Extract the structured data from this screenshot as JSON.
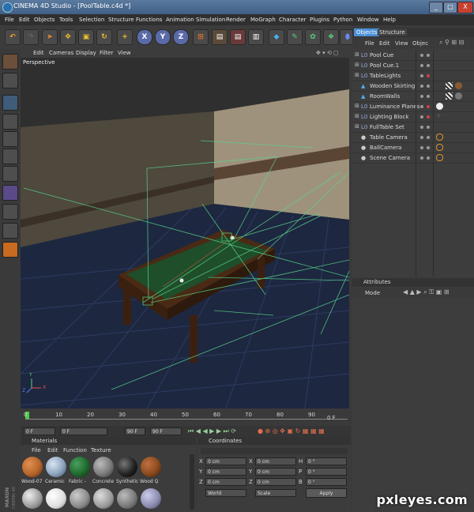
{
  "titlebar": {
    "title": "CINEMA 4D Studio - [PoolTable.c4d *]",
    "min": "_",
    "max": "□",
    "close": "X"
  },
  "menu": [
    "File",
    "Edit",
    "Objects",
    "Tools",
    "Selection",
    "Structure",
    "Functions",
    "Animation",
    "Simulation",
    "Render",
    "MoGraph",
    "Character",
    "Plugins",
    "Python",
    "Window",
    "Help"
  ],
  "toolbar": {
    "x": "X",
    "y": "Y",
    "z": "Z"
  },
  "viewport": {
    "menu": [
      "Edit",
      "Cameras",
      "Display",
      "Filter",
      "View"
    ],
    "label": "Perspective",
    "axis_y": "Y",
    "axis_z": "Z",
    "axis_x": "X"
  },
  "timeline": {
    "ticks": [
      "0",
      "10",
      "20",
      "30",
      "40",
      "50",
      "60",
      "70",
      "80",
      "90"
    ],
    "end": "0 F"
  },
  "transport": {
    "current": "0 F",
    "start": "0 F",
    "end1": "90 F",
    "end2": "90 F"
  },
  "materials": {
    "title": "Materials",
    "menu": [
      "File",
      "Edit",
      "Function",
      "Texture"
    ],
    "items": [
      {
        "name": "Wood-07",
        "color": "#b8652b"
      },
      {
        "name": "Ceramic",
        "color": "#8da4bf"
      },
      {
        "name": "Fabric -",
        "color": "#1e6b2c"
      },
      {
        "name": "Concrete",
        "color": "#7b7b7b"
      },
      {
        "name": "Synthetic",
        "color": "#222222"
      },
      {
        "name": "Wood Q",
        "color": "#8a4a1e"
      }
    ]
  },
  "coords": {
    "title": "Coordinates",
    "rows": [
      {
        "a": "X",
        "av": "0 cm",
        "b": "X",
        "bv": "0 cm",
        "c": "H",
        "cv": "0 °"
      },
      {
        "a": "Y",
        "av": "0 cm",
        "b": "Y",
        "bv": "0 cm",
        "c": "P",
        "cv": "0 °"
      },
      {
        "a": "Z",
        "av": "0 cm",
        "b": "Z",
        "bv": "0 cm",
        "c": "B",
        "cv": "0 °"
      }
    ],
    "mode1": "World",
    "mode2": "Scale",
    "apply": "Apply"
  },
  "objects": {
    "tab1": "Objects",
    "tab2": "Structure",
    "menu": [
      "File",
      "Edit",
      "View",
      "Objec"
    ],
    "rows": [
      {
        "name": "Pool Cue",
        "icon": "L0"
      },
      {
        "name": "Pool Cue.1",
        "icon": "L0"
      },
      {
        "name": "TableLights",
        "icon": "L0"
      },
      {
        "name": "Wooden Skirting",
        "icon": "▲"
      },
      {
        "name": "RoomWalls",
        "icon": "▲"
      },
      {
        "name": "Luminance Planes",
        "icon": "L0"
      },
      {
        "name": "Lighting Block",
        "icon": "L0"
      },
      {
        "name": "FullTable Set",
        "icon": "L0"
      },
      {
        "name": "Table Camera",
        "icon": "●"
      },
      {
        "name": "BallCamera",
        "icon": "●"
      },
      {
        "name": "Scene Camera",
        "icon": "●"
      }
    ]
  },
  "attributes": {
    "title": "Attributes",
    "mode": "Mode"
  },
  "watermark": "pxleyes.com",
  "colors": {
    "accent": "#4b8fd6",
    "wire": "#5bd68a",
    "felt": "#1f4e2a",
    "wall": "#a89a82",
    "floor": "#1e2a44"
  }
}
